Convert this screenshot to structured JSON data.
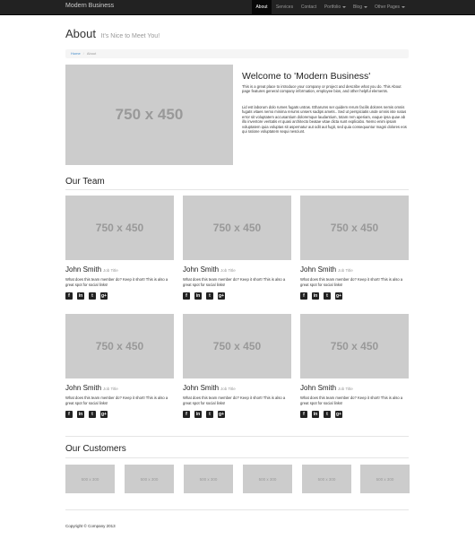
{
  "nav": {
    "brand": "Modern Business",
    "items": [
      {
        "label": "About",
        "active": true,
        "dropdown": false
      },
      {
        "label": "Services",
        "active": false,
        "dropdown": false
      },
      {
        "label": "Contact",
        "active": false,
        "dropdown": false
      },
      {
        "label": "Portfolio",
        "active": false,
        "dropdown": true
      },
      {
        "label": "Blog",
        "active": false,
        "dropdown": true
      },
      {
        "label": "Other Pages",
        "active": false,
        "dropdown": true
      }
    ]
  },
  "header": {
    "title": "About",
    "subtitle": "It's Nice to Meet You!"
  },
  "breadcrumb": {
    "home": "Home",
    "separator": "/",
    "current": "About"
  },
  "intro": {
    "image_label": "750 x 450",
    "title": "Welcome to 'Modern Business'",
    "paragraphs": [
      "This is a great place to introduce your company or project and describe what you do. This About page features general company information, employee bios, and other helpful elements.",
      "Lid est laborum dolo rumes fugats untras. Etharums ser quidem rerum facilis dolores nemis omnis fugats vitaes nemo minima rerums unsers sadips amets.. Sed ut perspiciatis unde omnis iste natus error sit voluptatem accusantium doloremque laudantium, totam rem aperiam, eaque ipsa quae ab illo inventore veritatis et quasi architecto beatae vitae dicta sunt explicabo. Nemo enim ipsam voluptatem quia voluptas sit aspernatur aut odit aut fugit, sed quia consequuntur magni dolores eos qui ratione voluptatem sequi nesciunt."
    ]
  },
  "team": {
    "heading": "Our Team",
    "members": [
      {
        "image_label": "750 x 450",
        "name": "John Smith",
        "job": "Job Title",
        "bio": "What does this team member do? Keep it short! This is also a great spot for social links!"
      },
      {
        "image_label": "750 x 450",
        "name": "John Smith",
        "job": "Job Title",
        "bio": "What does this team member do? Keep it short! This is also a great spot for social links!"
      },
      {
        "image_label": "750 x 450",
        "name": "John Smith",
        "job": "Job Title",
        "bio": "What does this team member do? Keep it short! This is also a great spot for social links!"
      },
      {
        "image_label": "750 x 450",
        "name": "John Smith",
        "job": "Job Title",
        "bio": "What does this team member do? Keep it short! This is also a great spot for social links!"
      },
      {
        "image_label": "750 x 450",
        "name": "John Smith",
        "job": "Job Title",
        "bio": "What does this team member do? Keep it short! This is also a great spot for social links!"
      },
      {
        "image_label": "750 x 450",
        "name": "John Smith",
        "job": "Job Title",
        "bio": "What does this team member do? Keep it short! This is also a great spot for social links!"
      }
    ],
    "social_icons": [
      "facebook-icon",
      "linkedin-icon",
      "twitter-icon",
      "google-plus-icon"
    ]
  },
  "customers": {
    "heading": "Our Customers",
    "logos": [
      "500 x 300",
      "500 x 300",
      "500 x 300",
      "500 x 300",
      "500 x 300",
      "500 x 300"
    ]
  },
  "footer": {
    "copyright": "Copyright © Company 2013"
  },
  "colors": {
    "navbar": "#222222",
    "placeholder": "#cccccc",
    "link": "#428bca"
  }
}
